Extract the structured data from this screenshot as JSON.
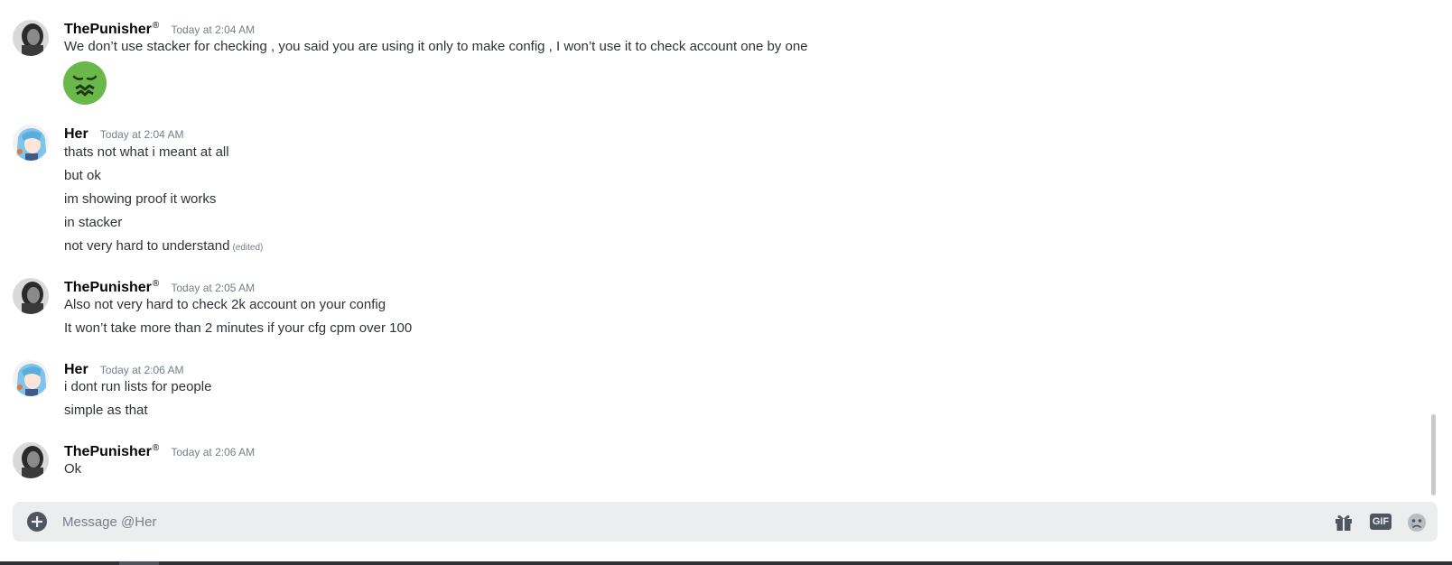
{
  "messages": [
    {
      "author": "ThePunisher",
      "badge": "®",
      "time": "Today at 2:04 AM",
      "avatar": "punisher-avatar",
      "lines": [
        "We don’t use stacker for checking , you said you are using it only to make config , I won’t use it to check account one by one"
      ],
      "emoji": "nauseated-face-emoji"
    },
    {
      "author": "Her",
      "time": "Today at 2:04 AM",
      "avatar": "her-avatar",
      "lines": [
        "thats not what i meant at all",
        "but ok",
        "im showing proof it works",
        "in stacker",
        "not very hard to understand"
      ],
      "edited_label": "(edited)"
    },
    {
      "author": "ThePunisher",
      "badge": "®",
      "time": "Today at 2:05 AM",
      "avatar": "punisher-avatar",
      "lines": [
        "Also not very hard to check 2k account on your config",
        "It won’t take more than 2 minutes if your cfg cpm over 100"
      ]
    },
    {
      "author": "Her",
      "time": "Today at 2:06 AM",
      "avatar": "her-avatar",
      "lines": [
        "i dont run lists for people",
        "simple as that"
      ]
    },
    {
      "author": "ThePunisher",
      "badge": "®",
      "time": "Today at 2:06 AM",
      "avatar": "punisher-avatar",
      "lines": [
        "Ok"
      ]
    }
  ],
  "composer": {
    "placeholder": "Message @Her",
    "gif_label": "GIF",
    "icons": [
      "plus-icon",
      "gift-icon",
      "gif-icon",
      "emoji-icon"
    ]
  },
  "colors": {
    "background": "#ffffff",
    "username": "#060607",
    "text": "#2e3338",
    "timestamp": "#747f8d",
    "composer_bg": "#ebedef",
    "icon": "#4f5660",
    "emoji_green": "#6bb84a"
  }
}
